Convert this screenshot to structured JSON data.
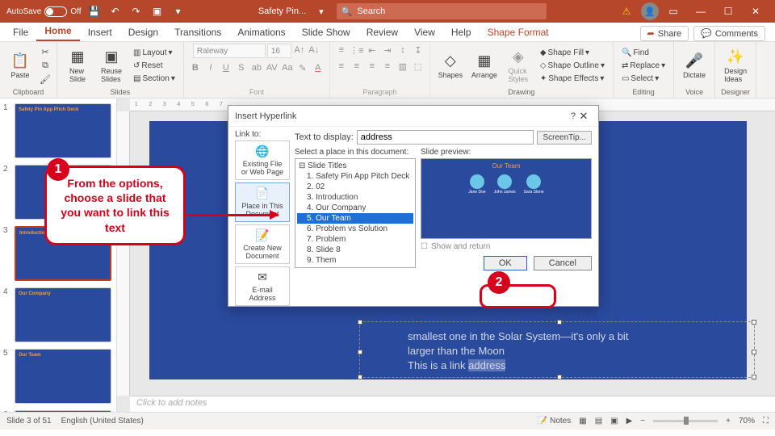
{
  "titlebar": {
    "autosave_label": "AutoSave",
    "autosave_state": "Off",
    "doc_name": "Safety Pin...",
    "search_placeholder": "Search"
  },
  "tabs": {
    "file": "File",
    "home": "Home",
    "insert": "Insert",
    "design": "Design",
    "transitions": "Transitions",
    "animations": "Animations",
    "slideshow": "Slide Show",
    "review": "Review",
    "view": "View",
    "help": "Help",
    "shapeformat": "Shape Format",
    "share": "Share",
    "comments": "Comments"
  },
  "ribbon": {
    "paste": "Paste",
    "clipboard": "Clipboard",
    "newslide": "New\nSlide",
    "reuse": "Reuse\nSlides",
    "layout": "Layout",
    "reset": "Reset",
    "section": "Section",
    "slides": "Slides",
    "font_name": "Raleway",
    "font_size": "16",
    "font": "Font",
    "paragraph": "Paragraph",
    "shapes": "Shapes",
    "arrange": "Arrange",
    "quick": "Quick\nStyles",
    "shapefill": "Shape Fill",
    "shapeoutline": "Shape Outline",
    "shapeeffects": "Shape Effects",
    "drawing": "Drawing",
    "find": "Find",
    "replace": "Replace",
    "select": "Select",
    "editing": "Editing",
    "dictate": "Dictate",
    "voice": "Voice",
    "designideas": "Design\nIdeas",
    "designer": "Designer"
  },
  "thumbs": {
    "titles": [
      "Safety Pin App\nPitch Deck",
      "",
      "Introduction",
      "Our Company",
      "Our Team",
      ""
    ]
  },
  "slide": {
    "line1": "smallest one in the Solar System—it's only a bit",
    "line2": "larger than the Moon",
    "line3_pre": "This is a link ",
    "line3_link": "address"
  },
  "notes_placeholder": "Click to add notes",
  "status": {
    "slide": "Slide 3 of 51",
    "lang": "English (United States)",
    "notes": "Notes",
    "zoom": "70%"
  },
  "dialog": {
    "title": "Insert Hyperlink",
    "link_to": "Link to:",
    "text_to_display": "Text to display:",
    "display_value": "address",
    "screentip": "ScreenTip...",
    "select_place": "Select a place in this document:",
    "preview_label": "Slide preview:",
    "show_return": "Show and return",
    "ok": "OK",
    "cancel": "Cancel",
    "places": {
      "existing": "Existing File\nor Web Page",
      "inthis": "Place in This\nDocument",
      "createnew": "Create New\nDocument",
      "email": "E-mail\nAddress"
    },
    "tree_root": "Slide Titles",
    "tree": [
      "1. Safety Pin App Pitch Deck",
      "2. 02",
      "3. Introduction",
      "4. Our Company",
      "5. Our Team",
      "6. Problem vs Solution",
      "7. Problem",
      "8. Slide 8",
      "9. Them"
    ],
    "preview_title": "Our Team",
    "people": [
      "Jane Doe",
      "John James",
      "Sara Stone"
    ]
  },
  "callout1": "From the options, choose a slide that you want to link this text",
  "badges": {
    "one": "1",
    "two": "2"
  }
}
